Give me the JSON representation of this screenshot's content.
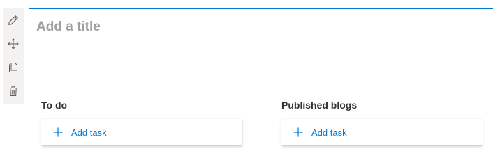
{
  "toolbar": {
    "tools": [
      {
        "name": "pencil-icon",
        "label": "Edit"
      },
      {
        "name": "move-icon",
        "label": "Move"
      },
      {
        "name": "copy-icon",
        "label": "Duplicate"
      },
      {
        "name": "trash-icon",
        "label": "Delete"
      }
    ]
  },
  "plan": {
    "title_value": "",
    "title_placeholder": "Add a title"
  },
  "buckets": [
    {
      "name": "To do",
      "add_task_label": "Add task"
    },
    {
      "name": "Published blogs",
      "add_task_label": "Add task"
    }
  ],
  "colors": {
    "accent": "#0078d4",
    "toolbar_bg": "#f3f2f1",
    "placeholder": "#a19f9d",
    "text": "#323130"
  }
}
